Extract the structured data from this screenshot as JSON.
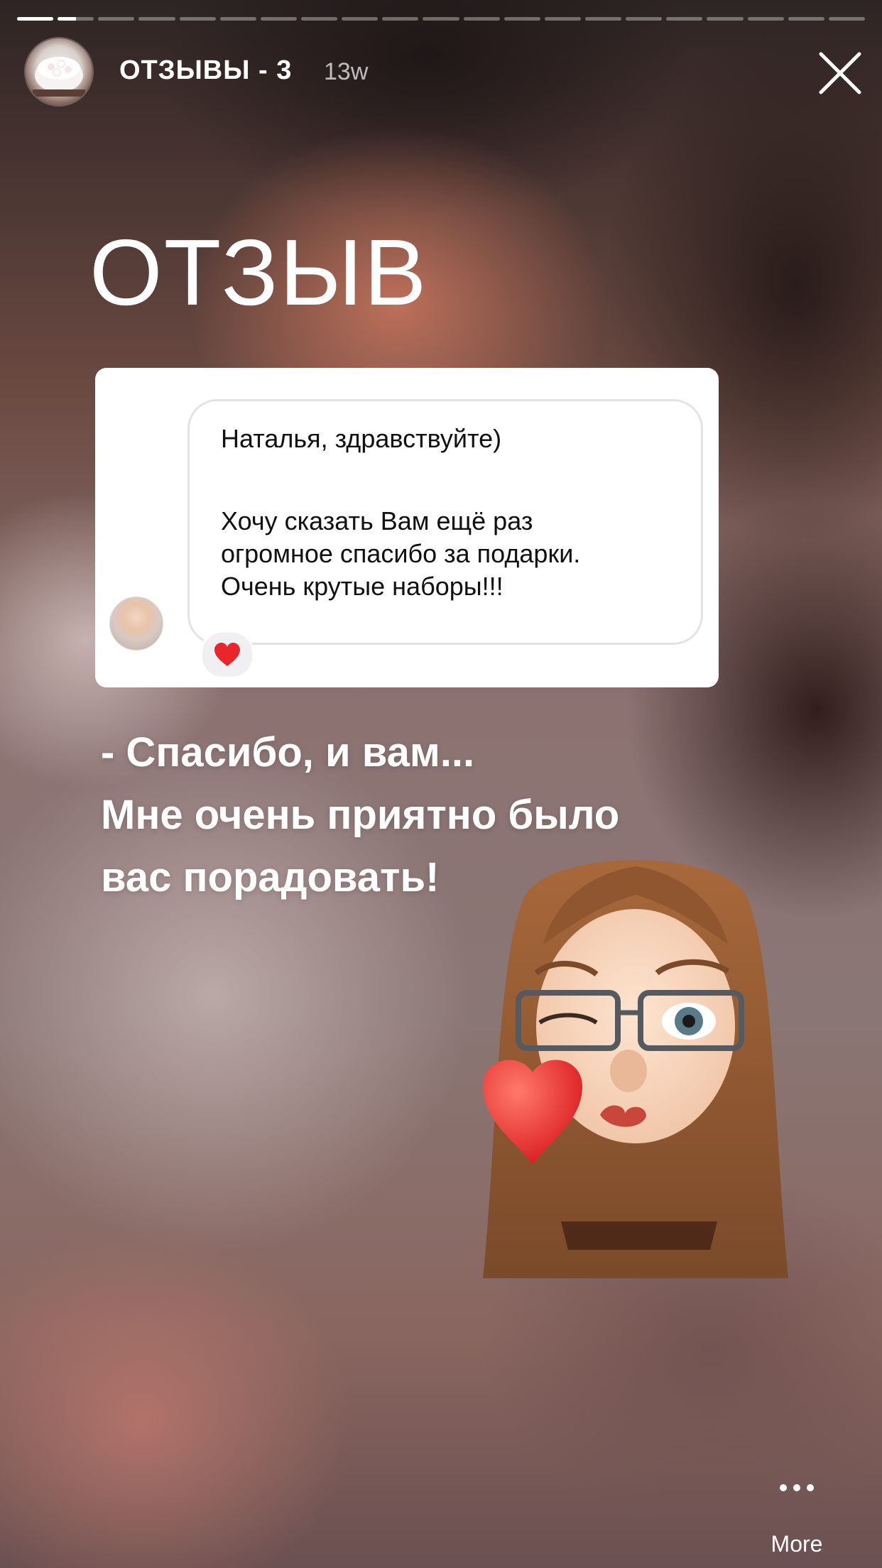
{
  "story": {
    "title": "ОТЗЫВЫ - 3",
    "time_ago": "13w",
    "progress": {
      "segments": 21,
      "completed": 1,
      "current_fraction": 0.5
    }
  },
  "content": {
    "headline": "ОТЗЫВ",
    "message": {
      "lines_1": [
        "Наталья, здравствуйте)"
      ],
      "lines_2": [
        "Хочу сказать Вам ещё раз",
        "огромное спасибо за подарки.",
        "Очень крутые наборы!!!"
      ],
      "reaction": "heart-icon"
    },
    "reply": [
      "- Спасибо, и вам...",
      "Мне очень приятно было",
      "вас порадовать!"
    ]
  },
  "controls": {
    "close_icon": "close-icon",
    "more_icon": "more-icon",
    "more_label": "More"
  },
  "colors": {
    "heart": "#e8262c",
    "white": "#ffffff",
    "bubble_border": "#e3e3e6"
  }
}
